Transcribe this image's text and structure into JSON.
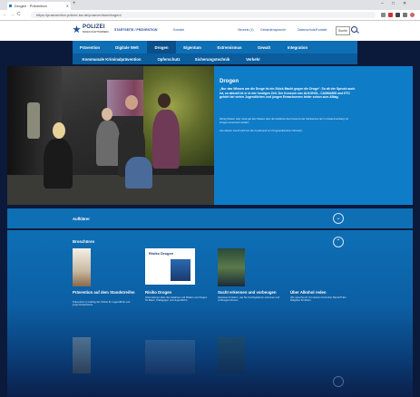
{
  "browser": {
    "tab_title": "Drogen · Prävention",
    "new_tab": "+",
    "url": "https://praevention.polizei-bw.de/praevention/drogen/",
    "win_controls": [
      "–",
      "□",
      "✕"
    ],
    "nav_glyphs": [
      "←",
      "→",
      "C"
    ]
  },
  "header": {
    "logo": "POLIZEI",
    "logo_sub": "BADEN-WÜRTTEMBERG",
    "links": [
      "STARTSEITE / PRÄVENTION",
      "Kontakt"
    ],
    "right_links": [
      "Hinweis (1)",
      "Gebärdensprache",
      "Datenschutz/Kontakt"
    ],
    "search_label": "Suche"
  },
  "nav": {
    "row1": [
      "Prävention",
      "Digitale Welt",
      "Drogen",
      "Eigentum",
      "Extremismus",
      "Gewalt",
      "Integration"
    ],
    "row2": [
      "Kommunale Kriminalprävention",
      "Opferschutz",
      "Sicherungstechnik",
      "Verkehr"
    ],
    "active": "Drogen"
  },
  "hero": {
    "title": "Drogen",
    "lead": "„Nur das Wissen um die Droge ist ein Stück Macht gegen die Droge“. So alt der Spruch auch ist, so aktuell ist er in der heutigen Zeit. Der Konsum von ALKOHOL, CANNABIS und ETC gehört bei vielen Jugendlichen und jungen Erwachsenen leider schon zum Alltag.",
    "p1": "Wenig Wissen oder meist gar kein Wissen über die Gefahren des Konsums der Substanzen der im Zusammenhang mit Drogen konsumiert werden.",
    "p2": "Aus diesem Grund wird hier die zunehmend um Drogenprävention informiert."
  },
  "accordion": {
    "aufklaerer": "Aufklärer",
    "broschueren": "Broschüren",
    "toggle_down": "⌄",
    "toggle_up": "⌃"
  },
  "brochures": [
    {
      "title": "Prävention auf dem Standstreifen",
      "text": "Prävention im Auftrag der Polizei für Jugendliche und junge Erwachsene.",
      "cover": ""
    },
    {
      "title": "Risiko Drogen",
      "text": "Informationen über die Gefahren und Risiken von Drogen für Eltern, Pädagogen und Jugendliche.",
      "cover": "Risiko Drogen"
    },
    {
      "title": "Sucht erkennen und vorbeugen",
      "text": "Hinweise für Eltern, wie Sie Suchtgefahren erkennen und vorbeugen können.",
      "cover": ""
    },
    {
      "title": "Über Alkohol reden",
      "text": "Wie spreche ich mit meinem Kind über Alkohol? Ein Ratgeber für Eltern.",
      "cover": ""
    }
  ],
  "colors": {
    "nav": "#0e6fb5",
    "hero": "#0f7cc7",
    "background": "#0b1a3a"
  }
}
